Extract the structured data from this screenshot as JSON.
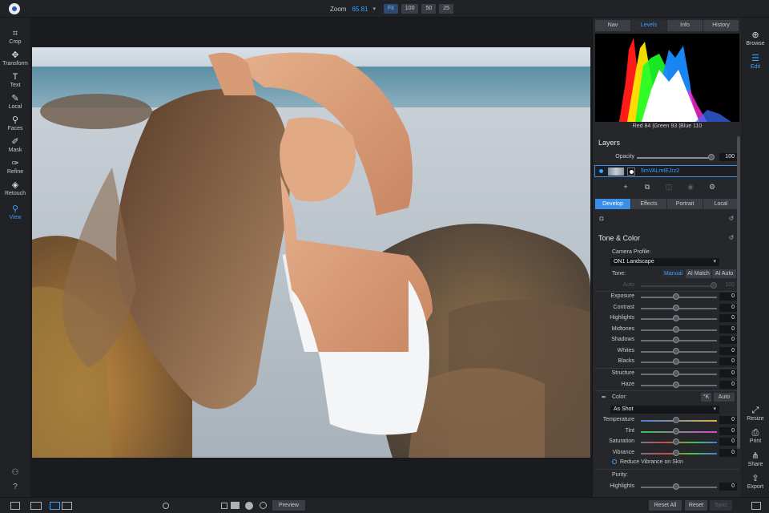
{
  "topbar": {
    "zoom_label": "Zoom",
    "zoom_value": "65.81",
    "zoom_buttons": [
      "Fit",
      "100",
      "50",
      "25"
    ],
    "zoom_active": "Fit"
  },
  "left_tools": [
    {
      "label": "Crop",
      "icon": "crop-icon"
    },
    {
      "label": "Transform",
      "icon": "move-icon"
    },
    {
      "label": "Text",
      "icon": "text-icon"
    },
    {
      "label": "Local",
      "icon": "brush-icon"
    },
    {
      "label": "Faces",
      "icon": "faces-icon"
    },
    {
      "label": "Mask",
      "icon": "mask-brush-icon"
    },
    {
      "label": "Refine",
      "icon": "refine-brush-icon"
    },
    {
      "label": "Retouch",
      "icon": "retouch-icon"
    },
    {
      "label": "View",
      "icon": "view-icon",
      "active": true
    }
  ],
  "right_modules": [
    {
      "label": "Browse",
      "icon": "browse-icon"
    },
    {
      "label": "Edit",
      "icon": "edit-sliders-icon",
      "active": true
    },
    {
      "label": "Resize",
      "icon": "resize-icon"
    },
    {
      "label": "Print",
      "icon": "print-icon"
    },
    {
      "label": "Share",
      "icon": "share-icon"
    },
    {
      "label": "Export",
      "icon": "export-icon"
    }
  ],
  "panel": {
    "top_tabs": [
      "Nav",
      "Levels",
      "Info",
      "History"
    ],
    "top_tab_active": "Levels",
    "rgb": {
      "red_label": "Red",
      "red": "84",
      "green_label": "Green",
      "green": "93",
      "blue_label": "Blue",
      "blue": "110"
    },
    "layers_title": "Layers",
    "opacity_label": "Opacity",
    "opacity_value": "100",
    "layer_name": "5mVALmtEJrz2",
    "mid_tabs": [
      "Develop",
      "Effects",
      "Portrait",
      "Local"
    ],
    "mid_tab_active": "Develop",
    "tone_color_title": "Tone & Color",
    "camera_profile_label": "Camera Profile:",
    "camera_profile_value": "ON1 Landscape",
    "tone_label": "Tone:",
    "tone_buttons": [
      "Manual",
      "AI Match",
      "AI Auto"
    ],
    "tone_active": "Manual",
    "auto_label": "Auto",
    "auto_value": "100",
    "tone_sliders": [
      {
        "label": "Exposure",
        "value": "0"
      },
      {
        "label": "Contrast",
        "value": "0"
      },
      {
        "label": "Highlights",
        "value": "0"
      },
      {
        "label": "Midtones",
        "value": "0"
      },
      {
        "label": "Shadows",
        "value": "0"
      },
      {
        "label": "Whites",
        "value": "0"
      },
      {
        "label": "Blacks",
        "value": "0"
      }
    ],
    "detail_sliders": [
      {
        "label": "Structure",
        "value": "0"
      },
      {
        "label": "Haze",
        "value": "0"
      }
    ],
    "color_label": "Color:",
    "color_auto": "Auto",
    "white_balance_value": "As Shot",
    "color_sliders": [
      {
        "label": "Temperature",
        "value": "0"
      },
      {
        "label": "Tint",
        "value": "0"
      },
      {
        "label": "Saturation",
        "value": "0"
      },
      {
        "label": "Vibrance",
        "value": "0"
      }
    ],
    "reduce_vibrance_label": "Reduce Vibrance on Skin",
    "purity_label": "Purity:",
    "purity_sliders": [
      {
        "label": "Highlights",
        "value": "0"
      }
    ]
  },
  "bottombar": {
    "preview_label": "Preview",
    "reset_all_label": "Reset All",
    "reset_label": "Reset",
    "sync_label": "Sync"
  }
}
